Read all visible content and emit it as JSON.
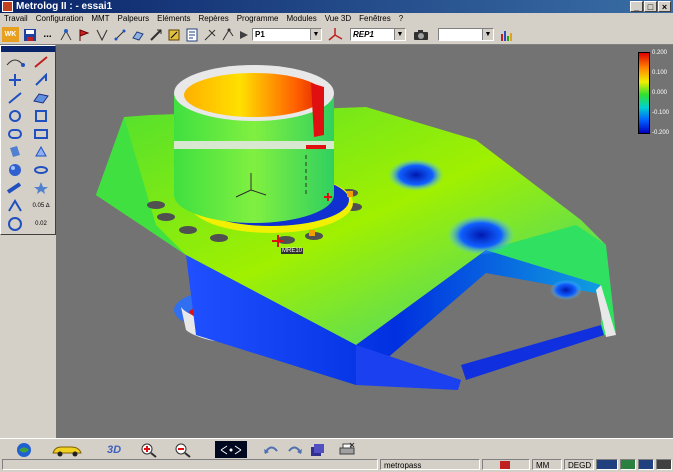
{
  "window": {
    "title": "Metrolog II : - essai1"
  },
  "menu": [
    "Travail",
    "Configuration",
    "MMT",
    "Palpeurs",
    "Eléments",
    "Repères",
    "Programme",
    "Modules",
    "Vue 3D",
    "Fenêtres",
    "?"
  ],
  "toolbar": {
    "wk_label": "WK",
    "dots": "...",
    "combo_point": "P1",
    "combo_repere": "REP1",
    "combo_empty": ""
  },
  "colorscale": {
    "labels": [
      "0.200",
      "0.100",
      "0.000",
      "-0.100",
      "-0.200"
    ],
    "top_color": "#e00000",
    "mid_color": "#30e030",
    "bottom_color": "#0000c0"
  },
  "viewport": {
    "point_label": "MRE10",
    "background": "#737373"
  },
  "palette": {
    "value_a": "0.05 ∆",
    "value_b": "0.02"
  },
  "bottom_toolbar": {
    "view_3d": "3D"
  },
  "status": {
    "user": "metropass",
    "units": "MM",
    "angle": "DEGD"
  }
}
